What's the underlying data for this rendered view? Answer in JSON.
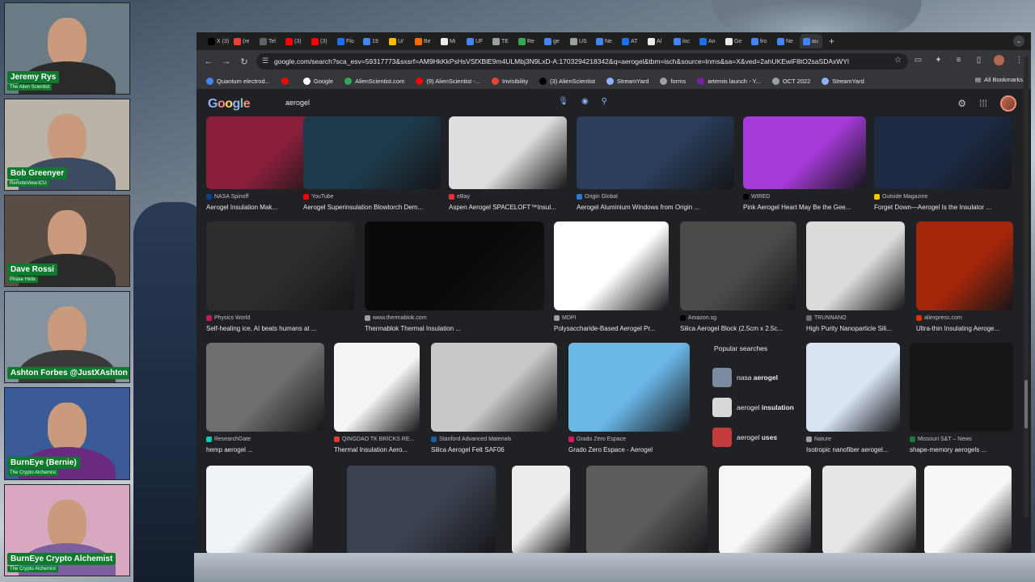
{
  "participants": [
    {
      "name": "Jeremy Rys",
      "sub": "The Alien Scientist",
      "bg": "#6a7b86",
      "shirt": "#2a2a2a"
    },
    {
      "name": "Bob Greenyer",
      "sub": "RemoteView.ICU",
      "bg": "#b9b3a8",
      "shirt": "#3c4a62"
    },
    {
      "name": "Dave Rossi",
      "sub": "Phase Helix",
      "bg": "#5a4d45",
      "shirt": "#2b2b2b"
    },
    {
      "name": "Ashton Forbes @JustXAshton",
      "sub": "",
      "bg": "#8592a0",
      "shirt": "#3a3a3a"
    },
    {
      "name": "BurnEye (Bernie)",
      "sub": "The Crypto Alchemist",
      "bg": "#3a5a9a",
      "shirt": "#6a2a80"
    },
    {
      "name": "BurnEye Crypto Alchemist",
      "sub": "The Crypto Alchemist",
      "bg": "#d7a8c0",
      "shirt": "#7d5fa0"
    }
  ],
  "browser": {
    "tabs": [
      {
        "label": "X (3)",
        "color": "#000000"
      },
      {
        "label": "(re",
        "color": "#ea4335"
      },
      {
        "label": "Tel",
        "color": "#5f6368"
      },
      {
        "label": "(3)",
        "color": "#ff0000"
      },
      {
        "label": "(3)",
        "color": "#ff0000"
      },
      {
        "label": "Flo",
        "color": "#1a73e8"
      },
      {
        "label": "19",
        "color": "#4285f4"
      },
      {
        "label": "U/",
        "color": "#fbbc04"
      },
      {
        "label": "Be",
        "color": "#ff6d00"
      },
      {
        "label": "Mi",
        "color": "#e8eaed"
      },
      {
        "label": "UF",
        "color": "#4285f4"
      },
      {
        "label": "TE",
        "color": "#9aa0a6"
      },
      {
        "label": "Re",
        "color": "#34a853"
      },
      {
        "label": "ge",
        "color": "#4285f4"
      },
      {
        "label": "US",
        "color": "#9aa0a6"
      },
      {
        "label": "Ne",
        "color": "#4285f4"
      },
      {
        "label": "AT",
        "color": "#1a73e8"
      },
      {
        "label": "Al",
        "color": "#e8eaed"
      },
      {
        "label": "loc",
        "color": "#4285f4"
      },
      {
        "label": "An",
        "color": "#1a73e8"
      },
      {
        "label": "Ge",
        "color": "#e8eaed"
      },
      {
        "label": "fro",
        "color": "#4285f4"
      },
      {
        "label": "Ne",
        "color": "#4285f4"
      },
      {
        "label": "au",
        "color": "#4285f4"
      }
    ],
    "new_tab": "+",
    "url": "google.com/search?sca_esv=59317773&sxsrf=AM9HkKkPsHsVSfXBlE9m4ULMbj3N9LxD-A:1703294218342&q=aerogel&tbm=isch&source=lnms&sa=X&ved=2ahUKEwiF8tO2saSDAxWYl",
    "bookmarks": [
      {
        "label": "Quantum electrod...",
        "color": "#4285f4"
      },
      {
        "label": "",
        "color": "#ff0000"
      },
      {
        "label": "Google",
        "color": "#ffffff"
      },
      {
        "label": "AlienScientist.com",
        "color": "#34a853"
      },
      {
        "label": "(9) AlienScientist -...",
        "color": "#ff0000"
      },
      {
        "label": "Invisibility",
        "color": "#ea4335"
      },
      {
        "label": "(3) AlienScientist",
        "color": "#000000"
      },
      {
        "label": "StreamYard",
        "color": "#8ab4f8"
      },
      {
        "label": "forms",
        "color": "#9aa0a6"
      },
      {
        "label": "artemis launch - Y...",
        "color": "#7b1fa2"
      },
      {
        "label": "OCT 2022",
        "color": "#9aa0a6"
      },
      {
        "label": "StreamYard",
        "color": "#8ab4f8"
      }
    ],
    "all_bookmarks": "All Bookmarks"
  },
  "google": {
    "query": "aerogel",
    "popular_title": "Popular searches",
    "popular": [
      {
        "pre": "nasa ",
        "bold": "aerogel",
        "color": "#7a8aa0"
      },
      {
        "pre": "aerogel ",
        "bold": "insulation",
        "color": "#d8d8d8"
      },
      {
        "pre": "aerogel ",
        "bold": "uses",
        "color": "#c43b3b"
      }
    ],
    "rows": [
      [
        {
          "source": "NASA Spinoff",
          "title": "Aerogel Insulation Mak...",
          "color": "#8a1f3c",
          "icolor": "#0b3d91"
        },
        {
          "source": "YouTube",
          "title": "Aerogel Superinsulation Blowtorch Dem...",
          "color": "#1d3a4a",
          "icolor": "#ff0000"
        },
        {
          "source": "eBay",
          "title": "Aspen Aerogel SPACELOFT™Insul...",
          "color": "#dedede",
          "icolor": "#e53238"
        },
        {
          "source": "Origin Global",
          "title": "Aerogel Aluminium Windows from Origin ...",
          "color": "#2a3e5c",
          "icolor": "#2a7dd1"
        },
        {
          "source": "WIRED",
          "title": "Pink Aerogel Heart May Be the Gee...",
          "color": "#a43ad8",
          "icolor": "#000000"
        },
        {
          "source": "Outside Magazine",
          "title": "Forget Down—Aerogel Is the Insulator ...",
          "color": "#1c2a44",
          "icolor": "#f5c400"
        }
      ],
      [
        {
          "source": "Physics World",
          "title": "Self-healing ice, AI beats humans at ...",
          "color": "#2d2d2d",
          "icolor": "#c2185b"
        },
        {
          "source": "www.thermablok.com",
          "title": "Thermablok Thermal Insulation ...",
          "color": "#0a0a0a",
          "icolor": "#9aa0a6"
        },
        {
          "source": "MDPI",
          "title": "Polysaccharide-Based Aerogel Pr...",
          "color": "#ffffff",
          "icolor": "#9aa0a6"
        },
        {
          "source": "Amazon.sg",
          "title": "Silica Aerogel Block (2.5cm x 2.5c...",
          "color": "#4a4a4a",
          "icolor": "#000000"
        },
        {
          "source": "TRUNNANO",
          "title": "High Purity Nanoparticle Sili...",
          "color": "#dcdcdc",
          "icolor": "#6d6d6d"
        },
        {
          "source": "aliexpress.com",
          "title": "Ultra-thin Insulating Aeroge...",
          "color": "#a4260b",
          "icolor": "#e62e04"
        }
      ],
      [
        {
          "source": "ResearchGate",
          "title": "hemp aerogel ...",
          "color": "#6e6e6e",
          "icolor": "#00ccbb"
        },
        {
          "source": "QINGDAO TK BRICKS RE...",
          "title": "Thermal Insulation Aero...",
          "color": "#f4f4f4",
          "icolor": "#e53935"
        },
        {
          "source": "Stanford Advanced Materials",
          "title": "Silica Aerogel Felt SAF06",
          "color": "#c8c8c8",
          "icolor": "#1e5aa8"
        },
        {
          "source": "Grado Zero Espace",
          "title": "Grado Zero Espace - Aerogel",
          "color": "#6ab7e8",
          "icolor": "#d81b60"
        },
        {
          "source": "Nature",
          "title": "Isotropic nanofiber aerogel...",
          "color": "#d8e4f4",
          "icolor": "#9aa0a6"
        },
        {
          "source": "Missouri S&T – News",
          "title": "shape-memory aerogels ...",
          "color": "#151515",
          "icolor": "#1b7a3e"
        }
      ],
      [
        {
          "color": "#f0f4f8"
        },
        {
          "color": "#3b4250"
        },
        {
          "color": "#ececec"
        },
        {
          "color": "#5c5c5c"
        },
        {
          "color": "#f6f6f6"
        },
        {
          "color": "#e6e6e6"
        },
        {
          "color": "#f8f8f8"
        }
      ]
    ]
  }
}
